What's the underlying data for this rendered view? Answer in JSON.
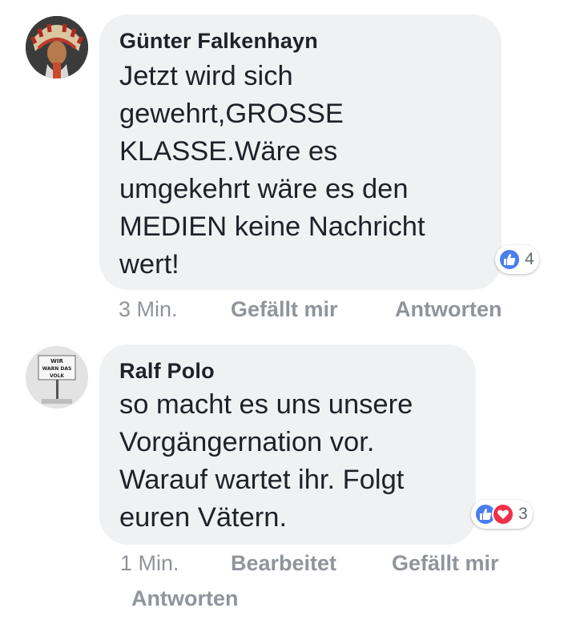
{
  "comments": [
    {
      "author": "Günter Falkenhayn",
      "text_lines": [
        "Jetzt wird sich",
        "gewehrt,GROSSE",
        "KLASSE.Wäre es",
        "umgekehrt wäre es den",
        "MEDIEN keine Nachricht",
        "wert!"
      ],
      "reactions": {
        "icons": [
          "like-icon"
        ],
        "count": "4"
      },
      "time": "3 Min.",
      "like_label": "Gefällt mir",
      "reply_label": "Antworten"
    },
    {
      "author": "Ralf Polo",
      "avatar_sign_lines": [
        "WIR",
        "WARN DAS",
        "VOLK"
      ],
      "text_lines": [
        "so macht es uns unsere",
        "Vorgängernation vor.",
        "Warauf wartet ihr. Folgt",
        "euren Vätern."
      ],
      "reactions": {
        "icons": [
          "like-icon",
          "love-icon"
        ],
        "count": "3"
      },
      "time": "1 Min.",
      "edited_label": "Bearbeitet",
      "like_label": "Gefällt mir",
      "reply_label": "Antworten"
    }
  ],
  "colors": {
    "bubble": "#f0f1f3",
    "text": "#1d2129",
    "meta": "#90949c",
    "like_blue": "#4a7ef0",
    "love_red": "#f0304a"
  }
}
